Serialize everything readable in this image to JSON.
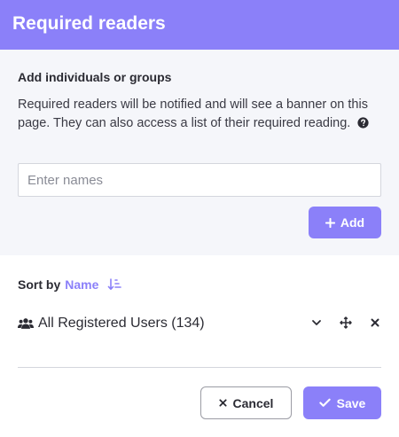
{
  "dialog": {
    "title": "Required readers",
    "accent_color": "#8b80f9"
  },
  "add_section": {
    "heading": "Add individuals or groups",
    "description": "Required readers will be notified and will see a banner on this page. They can also access a list of their required reading.",
    "help_icon": "question-circle-icon",
    "input": {
      "value": "",
      "placeholder": "Enter names"
    },
    "add_button": {
      "label": "Add",
      "icon": "plus-icon"
    }
  },
  "sort": {
    "label": "Sort by",
    "value": "Name",
    "icon": "sort-descending-icon"
  },
  "readers": [
    {
      "icon": "users-icon",
      "label": "All Registered Users (134)",
      "actions": [
        "chevron-down-icon",
        "move-icon",
        "close-icon"
      ]
    }
  ],
  "footer": {
    "cancel_button": {
      "label": "Cancel",
      "icon": "close-icon"
    },
    "save_button": {
      "label": "Save",
      "icon": "check-icon"
    }
  }
}
